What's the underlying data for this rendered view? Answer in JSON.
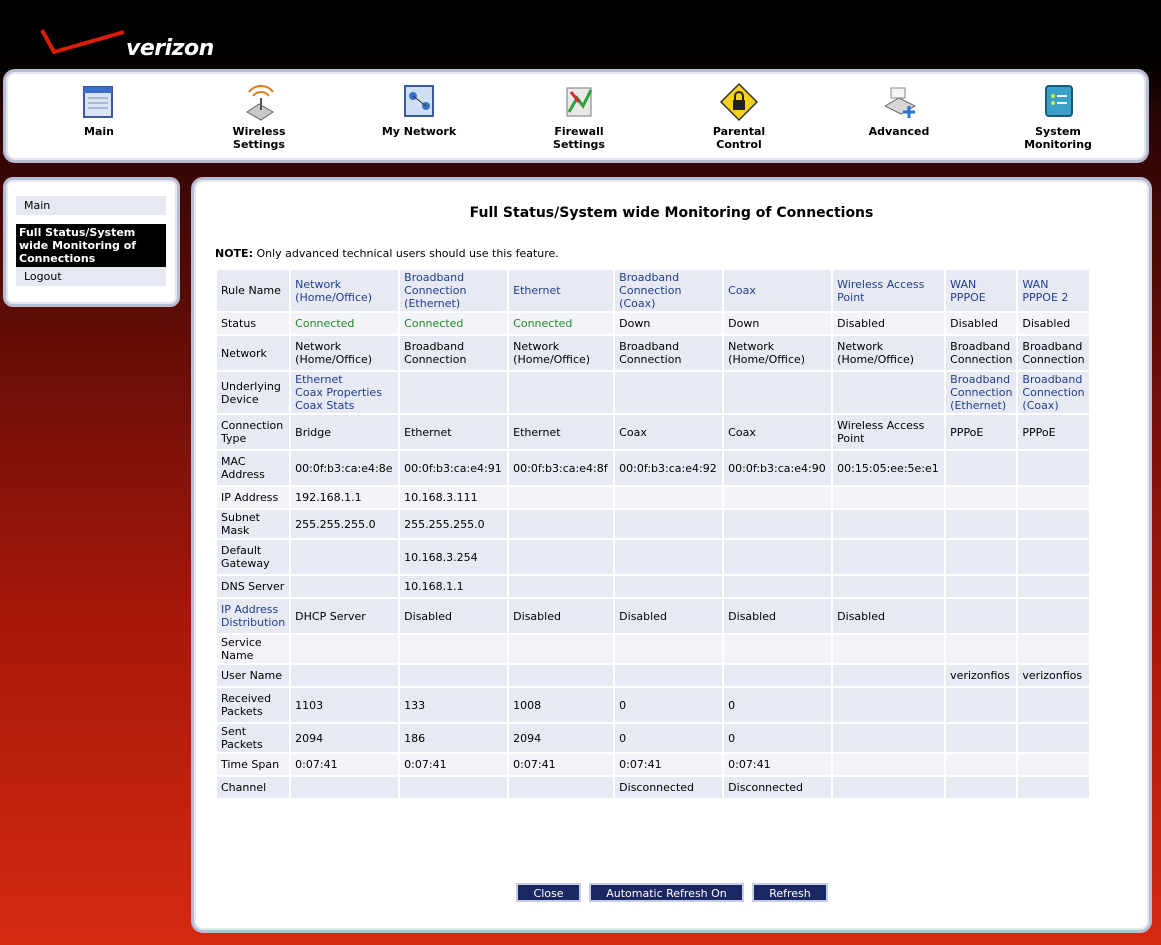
{
  "brand": "verizon",
  "nav": [
    {
      "label_1": "Main",
      "label_2": "",
      "icon": "main-icon"
    },
    {
      "label_1": "Wireless",
      "label_2": "Settings",
      "icon": "wireless-icon"
    },
    {
      "label_1": "My Network",
      "label_2": "",
      "icon": "network-icon"
    },
    {
      "label_1": "Firewall",
      "label_2": "Settings",
      "icon": "firewall-icon"
    },
    {
      "label_1": "Parental",
      "label_2": "Control",
      "icon": "lock-icon"
    },
    {
      "label_1": "Advanced",
      "label_2": "",
      "icon": "advanced-icon"
    },
    {
      "label_1": "System",
      "label_2": "Monitoring",
      "icon": "monitor-icon"
    }
  ],
  "sidebar": {
    "main": "Main",
    "active": "Full Status/System wide Monitoring of Connections",
    "logout": "Logout"
  },
  "title": "Full Status/System wide Monitoring of Connections",
  "note_label": "NOTE:",
  "note_text": "Only advanced technical users should use this feature.",
  "columns": [
    "Network (Home/Office)",
    "Broadband Connection (Ethernet)",
    "Ethernet",
    "Broadband Connection (Coax)",
    "Coax",
    "Wireless Access Point",
    "WAN PPPOE",
    "WAN PPPOE 2"
  ],
  "rows": [
    {
      "label": "Rule Name",
      "cells": [
        "Network (Home/Office)",
        "Broadband Connection (Ethernet)",
        "Ethernet",
        "Broadband Connection (Coax)",
        "Coax",
        "Wireless Access Point",
        "WAN PPPOE",
        "WAN PPPOE 2"
      ]
    },
    {
      "label": "Status",
      "cells": [
        "Connected",
        "Connected",
        "Connected",
        "Down",
        "Down",
        "Disabled",
        "Disabled",
        "Disabled"
      ]
    },
    {
      "label": "Network",
      "cells": [
        "Network (Home/Office)",
        "Broadband Connection",
        "Network (Home/Office)",
        "Broadband Connection",
        "Network (Home/Office)",
        "Network (Home/Office)",
        "Broadband Connection",
        "Broadband Connection"
      ]
    },
    {
      "label": "Underlying Device",
      "cells": [
        "Ethernet|Coax Properties|Coax Stats",
        "",
        "",
        "",
        "",
        "",
        "Broadband Connection (Ethernet)",
        "Broadband Connection (Coax)"
      ]
    },
    {
      "label": "Connection Type",
      "cells": [
        "Bridge",
        "Ethernet",
        "Ethernet",
        "Coax",
        "Coax",
        "Wireless Access Point",
        "PPPoE",
        "PPPoE"
      ]
    },
    {
      "label": "MAC Address",
      "cells": [
        "00:0f:b3:ca:e4:8e",
        "00:0f:b3:ca:e4:91",
        "00:0f:b3:ca:e4:8f",
        "00:0f:b3:ca:e4:92",
        "00:0f:b3:ca:e4:90",
        "00:15:05:ee:5e:e1",
        "",
        ""
      ]
    },
    {
      "label": "IP Address",
      "cells": [
        "192.168.1.1",
        "10.168.3.111",
        "",
        "",
        "",
        "",
        "",
        ""
      ]
    },
    {
      "label": "Subnet Mask",
      "cells": [
        "255.255.255.0",
        "255.255.255.0",
        "",
        "",
        "",
        "",
        "",
        ""
      ]
    },
    {
      "label": "Default Gateway",
      "cells": [
        "",
        "10.168.3.254",
        "",
        "",
        "",
        "",
        "",
        ""
      ]
    },
    {
      "label": "DNS Server",
      "cells": [
        "",
        "10.168.1.1",
        "",
        "",
        "",
        "",
        "",
        ""
      ]
    },
    {
      "label": "IP Address Distribution",
      "cells": [
        "DHCP Server",
        "Disabled",
        "Disabled",
        "Disabled",
        "Disabled",
        "Disabled",
        "",
        ""
      ]
    },
    {
      "label": "Service Name",
      "cells": [
        "",
        "",
        "",
        "",
        "",
        "",
        "",
        ""
      ]
    },
    {
      "label": "User Name",
      "cells": [
        "",
        "",
        "",
        "",
        "",
        "",
        "verizonfios",
        "verizonfios"
      ]
    },
    {
      "label": "Received Packets",
      "cells": [
        "1103",
        "133",
        "1008",
        "0",
        "0",
        "",
        "",
        ""
      ]
    },
    {
      "label": "Sent Packets",
      "cells": [
        "2094",
        "186",
        "2094",
        "0",
        "0",
        "",
        "",
        ""
      ]
    },
    {
      "label": "Time Span",
      "cells": [
        "0:07:41",
        "0:07:41",
        "0:07:41",
        "0:07:41",
        "0:07:41",
        "",
        "",
        ""
      ]
    },
    {
      "label": "Channel",
      "cells": [
        "",
        "",
        "",
        "Disconnected",
        "Disconnected",
        "",
        "",
        ""
      ]
    }
  ],
  "buttons": {
    "close": "Close",
    "auto_refresh": "Automatic Refresh On",
    "refresh": "Refresh"
  },
  "colors": {
    "link": "#1f3d8c",
    "connected": "#1f8a22",
    "button_bg": "#1b2763",
    "cell_bg": "#e8eaf3"
  }
}
